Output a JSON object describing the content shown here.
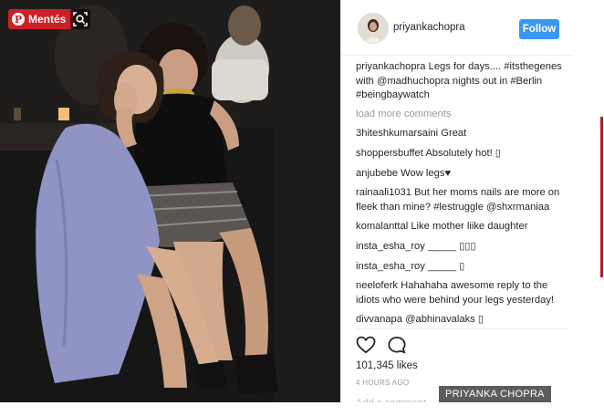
{
  "pin_button": {
    "label": "Mentés",
    "logo": "P"
  },
  "post": {
    "username": "priyankachopra",
    "follow_label": "Follow",
    "caption_user": "priyankachopra",
    "caption_text": "Legs for days.... #itsthegenes with @madhuchopra nights out in #Berlin #beingbaywatch",
    "load_more": "load more comments",
    "comments": [
      {
        "user": "3hiteshkumarsaini",
        "text": "Great"
      },
      {
        "user": "shoppersbuffet",
        "text": "Absolutely hot! ▯"
      },
      {
        "user": "anjubebe",
        "text": "Wow legs♥"
      },
      {
        "user": "rainaali1031",
        "text": "But her moms nails are more on fleek than mine? #lestruggle @shxrmaniaa"
      },
      {
        "user": "komalanttal",
        "text": "Like mother liike daughter"
      },
      {
        "user": "insta_esha_roy",
        "text": "_____ ▯▯▯"
      },
      {
        "user": "insta_esha_roy",
        "text": "_____ ▯"
      },
      {
        "user": "neeloferk",
        "text": "Hahahaha awesome reply to the idiots who were behind your legs yesterday!"
      },
      {
        "user": "divvanapa",
        "text": "@abhinavalaks ▯"
      }
    ],
    "likes": "101,345 likes",
    "time_ago": "4 HOURS AGO",
    "add_comment": "Add a comment..."
  },
  "photo_credit": "PRIYANKA CHOPRA",
  "icons": {
    "pin": "pinterest-logo-icon",
    "lens": "visual-search-icon",
    "like": "heart-icon",
    "comment": "comment-bubble-icon"
  },
  "colors": {
    "pinterest_red": "#cb2027",
    "follow_blue": "#3897f0",
    "credit_bg": "#5c5c5c"
  }
}
